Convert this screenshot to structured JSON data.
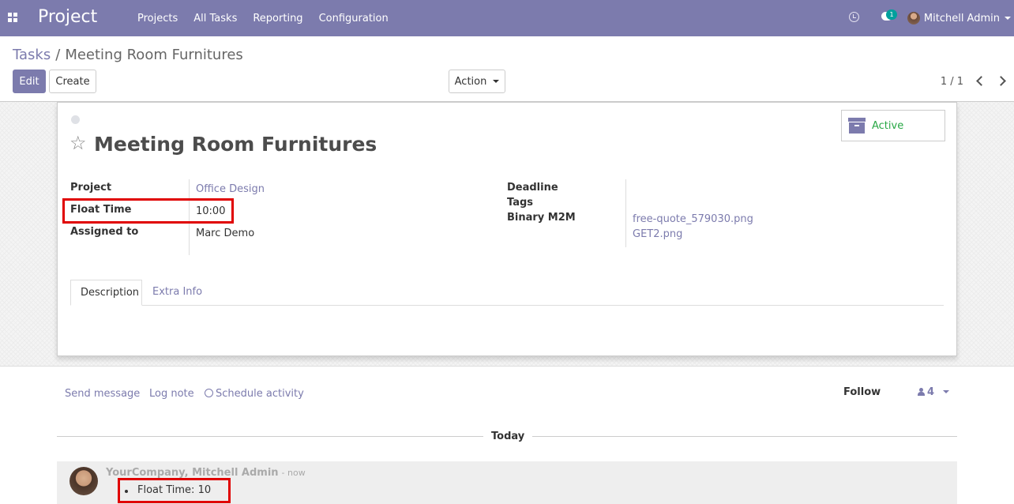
{
  "navbar": {
    "brand": "Project",
    "menu": [
      "Projects",
      "All Tasks",
      "Reporting",
      "Configuration"
    ],
    "chat_count": "1",
    "user_name": "Mitchell Admin"
  },
  "control": {
    "breadcrumb_parent": "Tasks",
    "breadcrumb_sep": "/",
    "breadcrumb_current": "Meeting Room Furnitures",
    "edit_label": "Edit",
    "create_label": "Create",
    "action_label": "Action",
    "pager": "1 / 1"
  },
  "form": {
    "title": "Meeting Room Furnitures",
    "active_label": "Active",
    "fields_left": {
      "project_label": "Project",
      "project_value": "Office Design",
      "float_time_label": "Float Time",
      "float_time_value": "10:00",
      "assigned_label": "Assigned to",
      "assigned_value": "Marc Demo"
    },
    "fields_right": {
      "deadline_label": "Deadline",
      "tags_label": "Tags",
      "binary_label": "Binary M2M",
      "files": [
        "free-quote_579030.png",
        "GET2.png"
      ]
    },
    "tabs": [
      "Description",
      "Extra Info"
    ]
  },
  "chatter": {
    "send_message": "Send message",
    "log_note": "Log note",
    "schedule_activity": "Schedule activity",
    "follow": "Follow",
    "followers_count": "4",
    "today": "Today",
    "message": {
      "author": "YourCompany, Mitchell Admin",
      "time": "- now",
      "body": "Float Time: 10"
    }
  },
  "colors": {
    "brand": "#7c7bad",
    "highlight": "#e00000",
    "active": "#28a745"
  }
}
